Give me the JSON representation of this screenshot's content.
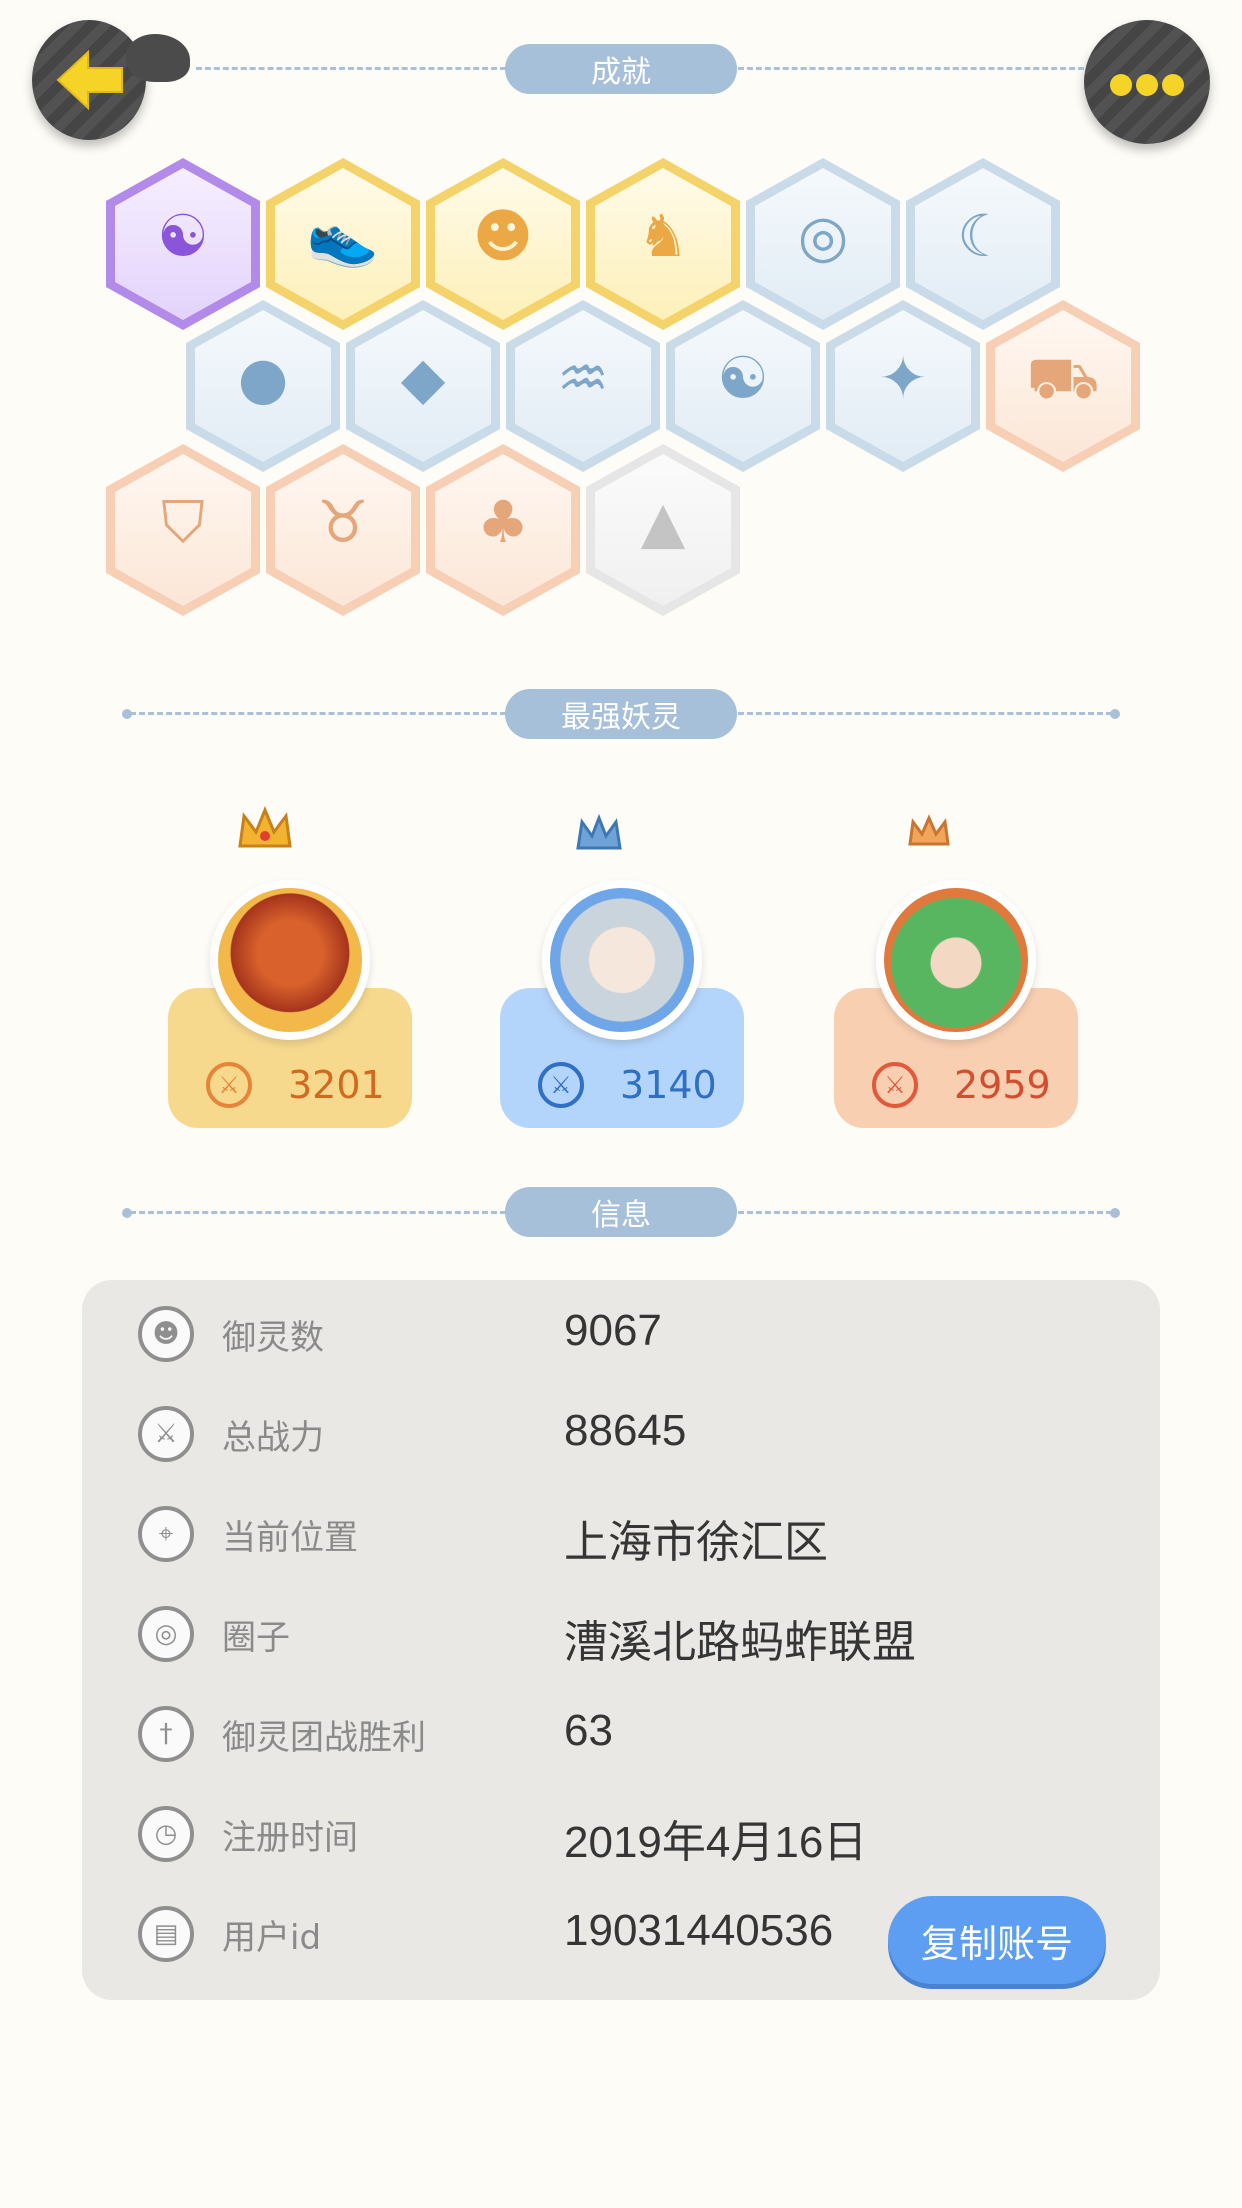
{
  "sections": {
    "achievements": "成就",
    "strongest_spirits": "最强妖灵",
    "info": "信息"
  },
  "achievement_badges": [
    {
      "icon": "yin-yang-icon",
      "tier": "purple"
    },
    {
      "icon": "sneaker-icon",
      "tier": "gold"
    },
    {
      "icon": "spirit-face-icon",
      "tier": "gold"
    },
    {
      "icon": "fox-spirit-icon",
      "tier": "gold"
    },
    {
      "icon": "radar-icon",
      "tier": "blue"
    },
    {
      "icon": "moon-icon",
      "tier": "blue"
    },
    {
      "icon": "orb-icon",
      "tier": "blue"
    },
    {
      "icon": "crystal-icon",
      "tier": "blue"
    },
    {
      "icon": "water-spirit-icon",
      "tier": "blue"
    },
    {
      "icon": "yin-yang-card-icon",
      "tier": "blue"
    },
    {
      "icon": "dragon-icon",
      "tier": "blue"
    },
    {
      "icon": "cat-cart-icon",
      "tier": "orange"
    },
    {
      "icon": "shield-icon",
      "tier": "orange"
    },
    {
      "icon": "horned-spirit-icon",
      "tier": "orange"
    },
    {
      "icon": "cat-pair-icon",
      "tier": "orange"
    },
    {
      "icon": "wolf-book-icon",
      "tier": "grey"
    }
  ],
  "spirits": [
    {
      "rank": 1,
      "score": "3201",
      "style": "gold"
    },
    {
      "rank": 2,
      "score": "3140",
      "style": "blue"
    },
    {
      "rank": 3,
      "score": "2959",
      "style": "orange"
    }
  ],
  "info": {
    "spirit_count": {
      "label": "御灵数",
      "value": "9067",
      "icon": "spirit-icon"
    },
    "total_power": {
      "label": "总战力",
      "value": "88645",
      "icon": "sword-icon"
    },
    "location": {
      "label": "当前位置",
      "value": "上海市徐汇区",
      "icon": "location-pin-icon"
    },
    "circle": {
      "label": "圈子",
      "value": "漕溪北路蚂蚱联盟",
      "icon": "circle-target-icon"
    },
    "team_battle_wins": {
      "label": "御灵团战胜利",
      "value": "63",
      "icon": "flag-sword-icon"
    },
    "register_time": {
      "label": "注册时间",
      "value": "2019年4月16日",
      "icon": "clock-icon"
    },
    "user_id": {
      "label": "用户id",
      "value": "19031440536",
      "icon": "id-card-icon"
    }
  },
  "copy_button": "复制账号",
  "colors": {
    "background": "#fdfcf7",
    "pill": "#a6c0d9",
    "copy_button": "#5d9ef2",
    "back_arrow": "#f5d327"
  }
}
